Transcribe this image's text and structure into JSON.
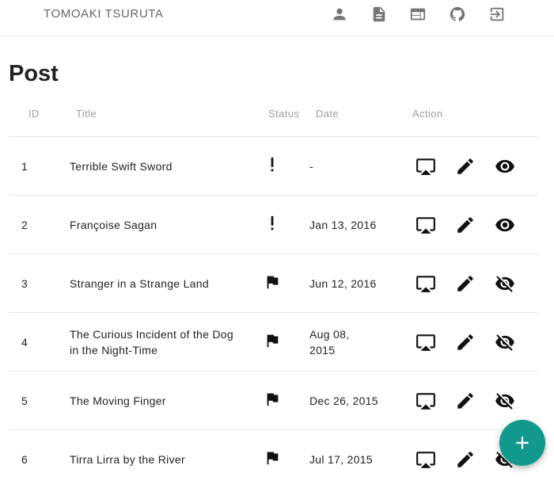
{
  "header": {
    "brand": "TOMOAKI TSURUTA",
    "nav_icons": [
      "person-icon",
      "document-icon",
      "web-icon",
      "github-icon",
      "exit-icon"
    ]
  },
  "page": {
    "title": "Post"
  },
  "table": {
    "columns": [
      "ID",
      "Title",
      "Status",
      "Date",
      "Action"
    ],
    "rows": [
      {
        "id": "1",
        "title": "Terrible Swift Sword",
        "status": "exclamation",
        "date": "-",
        "visibility": "visible"
      },
      {
        "id": "2",
        "title": "Françoise Sagan",
        "status": "exclamation",
        "date": "Jan 13, 2016",
        "visibility": "visible"
      },
      {
        "id": "3",
        "title": "Stranger in a Strange Land",
        "status": "flag",
        "date": "Jun 12, 2016",
        "visibility": "hidden"
      },
      {
        "id": "4",
        "title": "The Curious Incident of the Dog in the Night-Time",
        "status": "flag",
        "date": "Aug 08, 2015",
        "visibility": "hidden"
      },
      {
        "id": "5",
        "title": "The Moving Finger",
        "status": "flag",
        "date": "Dec 26, 2015",
        "visibility": "hidden"
      },
      {
        "id": "6",
        "title": "Tirra Lirra by the River",
        "status": "flag",
        "date": "Jul 17, 2015",
        "visibility": "hidden"
      }
    ],
    "actions": [
      "cast-icon",
      "edit-icon",
      "visibility-icon"
    ]
  },
  "fab": {
    "icon": "add-icon",
    "color": "#11998e"
  }
}
